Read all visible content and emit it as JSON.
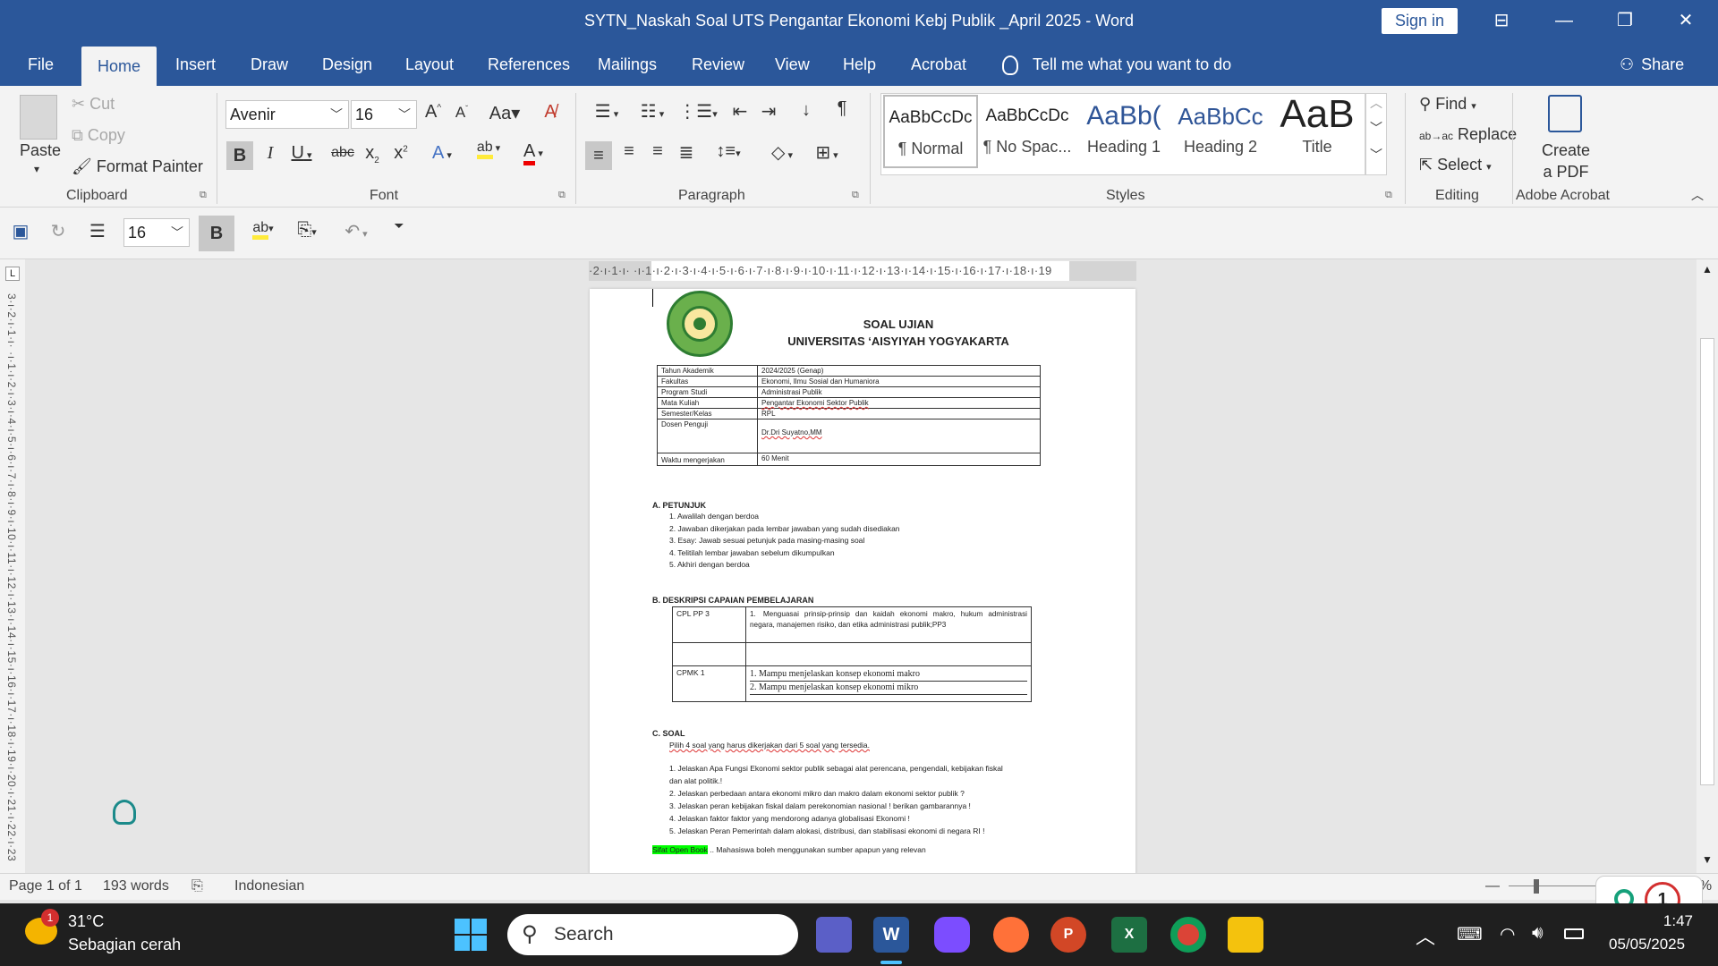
{
  "window": {
    "title": "SYTN_Naskah Soal UTS  Pengantar Ekonomi Kebj Publik _April 2025  -  Word",
    "sign_in": "Sign in"
  },
  "menu": {
    "tabs": [
      "File",
      "Home",
      "Insert",
      "Draw",
      "Design",
      "Layout",
      "References",
      "Mailings",
      "Review",
      "View",
      "Help",
      "Acrobat"
    ],
    "tell_me": "Tell me what you want to do",
    "share": "Share"
  },
  "ribbon": {
    "clipboard": {
      "paste": "Paste",
      "cut": "Cut",
      "copy": "Copy",
      "format_painter": "Format Painter",
      "label": "Clipboard"
    },
    "font": {
      "name": "Avenir",
      "size": "16",
      "label": "Font"
    },
    "paragraph": {
      "label": "Paragraph"
    },
    "styles": {
      "items": [
        {
          "preview": "AaBbCcDc",
          "name": "¶ Normal"
        },
        {
          "preview": "AaBbCcDc",
          "name": "¶ No Spac..."
        },
        {
          "preview": "AaBb(",
          "name": "Heading 1"
        },
        {
          "preview": "AaBbCc",
          "name": "Heading 2"
        },
        {
          "preview": "AaB",
          "name": "Title"
        }
      ],
      "label": "Styles"
    },
    "editing": {
      "find": "Find",
      "replace": "Replace",
      "select": "Select",
      "label": "Editing"
    },
    "acrobat": {
      "create_pdf": "Create a PDF",
      "label": "Adobe Acrobat"
    }
  },
  "qat": {
    "font_size": "16"
  },
  "ruler": {
    "horizontal": "·2·ı·1·ı·  ·ı·1·ı·2·ı·3·ı·4·ı·5·ı·6·ı·7·ı·8·ı·9·ı·10·ı·11·ı·12·ı·13·ı·14·ı·15·ı·16·ı·17·ı·18·ı·19",
    "vertical": "3·ı·2·ı·1·ı·  ·ı·1·ı·2·ı·3·ı·4·ı·5·ı·6·ı·7·ı·8·ı·9·ı·10·ı·11·ı·12·ı·13·ı·14·ı·15·ı·16·ı·17·ı·18·ı·19·ı·20·ı·21·ı·22·ı·23"
  },
  "document": {
    "header_line1": "SOAL UJIAN",
    "header_line2": "UNIVERSITAS ‘AISYIYAH YOGYAKARTA",
    "logo_text": "UNIVERSITAS ‘AISYIYAH YOGYAKARTA",
    "info_rows": [
      {
        "label": "Tahun Akademik",
        "value": "2024/2025 (Genap)"
      },
      {
        "label": "Fakultas",
        "value": "Ekonomi, Ilmu Sosial dan Humaniora"
      },
      {
        "label": "Program Studi",
        "value": "Administrasi Publik"
      },
      {
        "label": "Mata Kuliah",
        "value": "Pengantar Ekonomi Sektor Publik"
      },
      {
        "label": "Semester/Kelas",
        "value": "RPL"
      },
      {
        "label": "Dosen Penguji",
        "value": "Dr.Dri Suyatno,MM"
      },
      {
        "label": "Waktu mengerjakan",
        "value": "60 Menit"
      }
    ],
    "section_a": "A.    PETUNJUK",
    "petunjuk": [
      "1.    Awalilah dengan berdoa",
      "2.    Jawaban dikerjakan pada lembar jawaban yang sudah disediakan",
      "3.    Esay: Jawab sesuai petunjuk pada masing-masing soal",
      "4.    Telitilah lembar jawaban sebelum dikumpulkan",
      "5.    Akhiri dengan berdoa"
    ],
    "section_b": "B.    DESKRIPSI CAPAIAN PEMBELAJARAN",
    "cpl_label": "CPL PP 3",
    "cpl_text": "Menguasai prinsip-prinsip dan kaidah  ekonomi makro,  hukum administrasi  negara,  manajemen  risiko,  dan  etika administrasi publik;PP3",
    "cpl_num": "1.",
    "cpmk_label": "CPMK 1",
    "cpmk_items": [
      "1.    Mampu menjelaskan konsep ekonomi makro",
      "2.    Mampu menjelaskan konsep ekonomi mikro"
    ],
    "section_c": "C.    SOAL",
    "soal_intro": "Pilih 4 soal yang harus dikerjakan dari 5 soal yang tersedia.",
    "soal": [
      "1.    Jelaskan Apa Fungsi Ekonomi sektor  publik sebagai alat perencana, pengendali, kebijakan fiskal",
      "        dan alat politik.!",
      "2.    Jelaskan perbedaan antara ekonomi mikro dan makro dalam ekonomi sektor publik ?",
      "3.    Jelaskan peran kebijakan fiskal dalam perekonomian nasional ! berikan gambarannya !",
      "4.    Jelaskan faktor faktor yang mendorong adanya globalisasi Ekonomi !",
      "5.    Jelaskan Peran Pemerintah dalam alokasi, distribusi, dan stabilisasi ekonomi di negara RI !"
    ],
    "open_book": "Sifat Open Book",
    "open_book_rest": "  .. Mahasiswa boleh menggunakan sumber apapun yang relevan"
  },
  "status": {
    "page": "Page 1 of 1",
    "words": "193 words",
    "language": "Indonesian",
    "zoom": "0%"
  },
  "notification": {
    "count": "1"
  },
  "taskbar": {
    "weather_temp": "31°C",
    "weather_desc": "Sebagian cerah",
    "weather_badge": "1",
    "search": "Search",
    "time": "1:47",
    "date": "05/05/2025"
  },
  "colors": {
    "word_blue": "#2b579a",
    "ribbon_bg": "#f3f3f3",
    "taskbar": "#1f1f1f"
  }
}
